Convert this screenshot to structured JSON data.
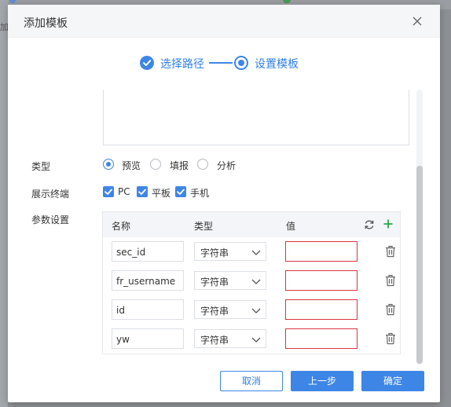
{
  "dialog": {
    "title": "添加模板"
  },
  "background": {
    "left_char": "加"
  },
  "steps": [
    {
      "label": "选择路径",
      "status": "done"
    },
    {
      "label": "设置模板",
      "status": "active"
    }
  ],
  "type_row": {
    "label": "类型",
    "options": [
      {
        "label": "预览",
        "checked": true
      },
      {
        "label": "填报",
        "checked": false
      },
      {
        "label": "分析",
        "checked": false
      }
    ]
  },
  "terminal_row": {
    "label": "展示终端",
    "options": [
      {
        "label": "PC",
        "checked": true
      },
      {
        "label": "平板",
        "checked": true
      },
      {
        "label": "手机",
        "checked": true
      }
    ]
  },
  "params": {
    "label": "参数设置",
    "columns": {
      "name": "名称",
      "type": "类型",
      "value": "值"
    },
    "rows": [
      {
        "name": "sec_id",
        "type": "字符串",
        "value": ""
      },
      {
        "name": "fr_username",
        "type": "字符串",
        "value": ""
      },
      {
        "name": "id",
        "type": "字符串",
        "value": ""
      },
      {
        "name": "yw",
        "type": "字符串",
        "value": ""
      }
    ]
  },
  "buttons": {
    "cancel": "取消",
    "prev": "上一步",
    "ok": "确定"
  },
  "colors": {
    "primary": "#3e86e6",
    "error_border": "#d9363e",
    "add_icon": "#2aa845"
  },
  "icons": {
    "close": "close-icon",
    "check": "check-icon",
    "refresh": "refresh-icon",
    "add": "plus-icon",
    "delete": "trash-icon",
    "dropdown": "chevron-down-icon"
  }
}
